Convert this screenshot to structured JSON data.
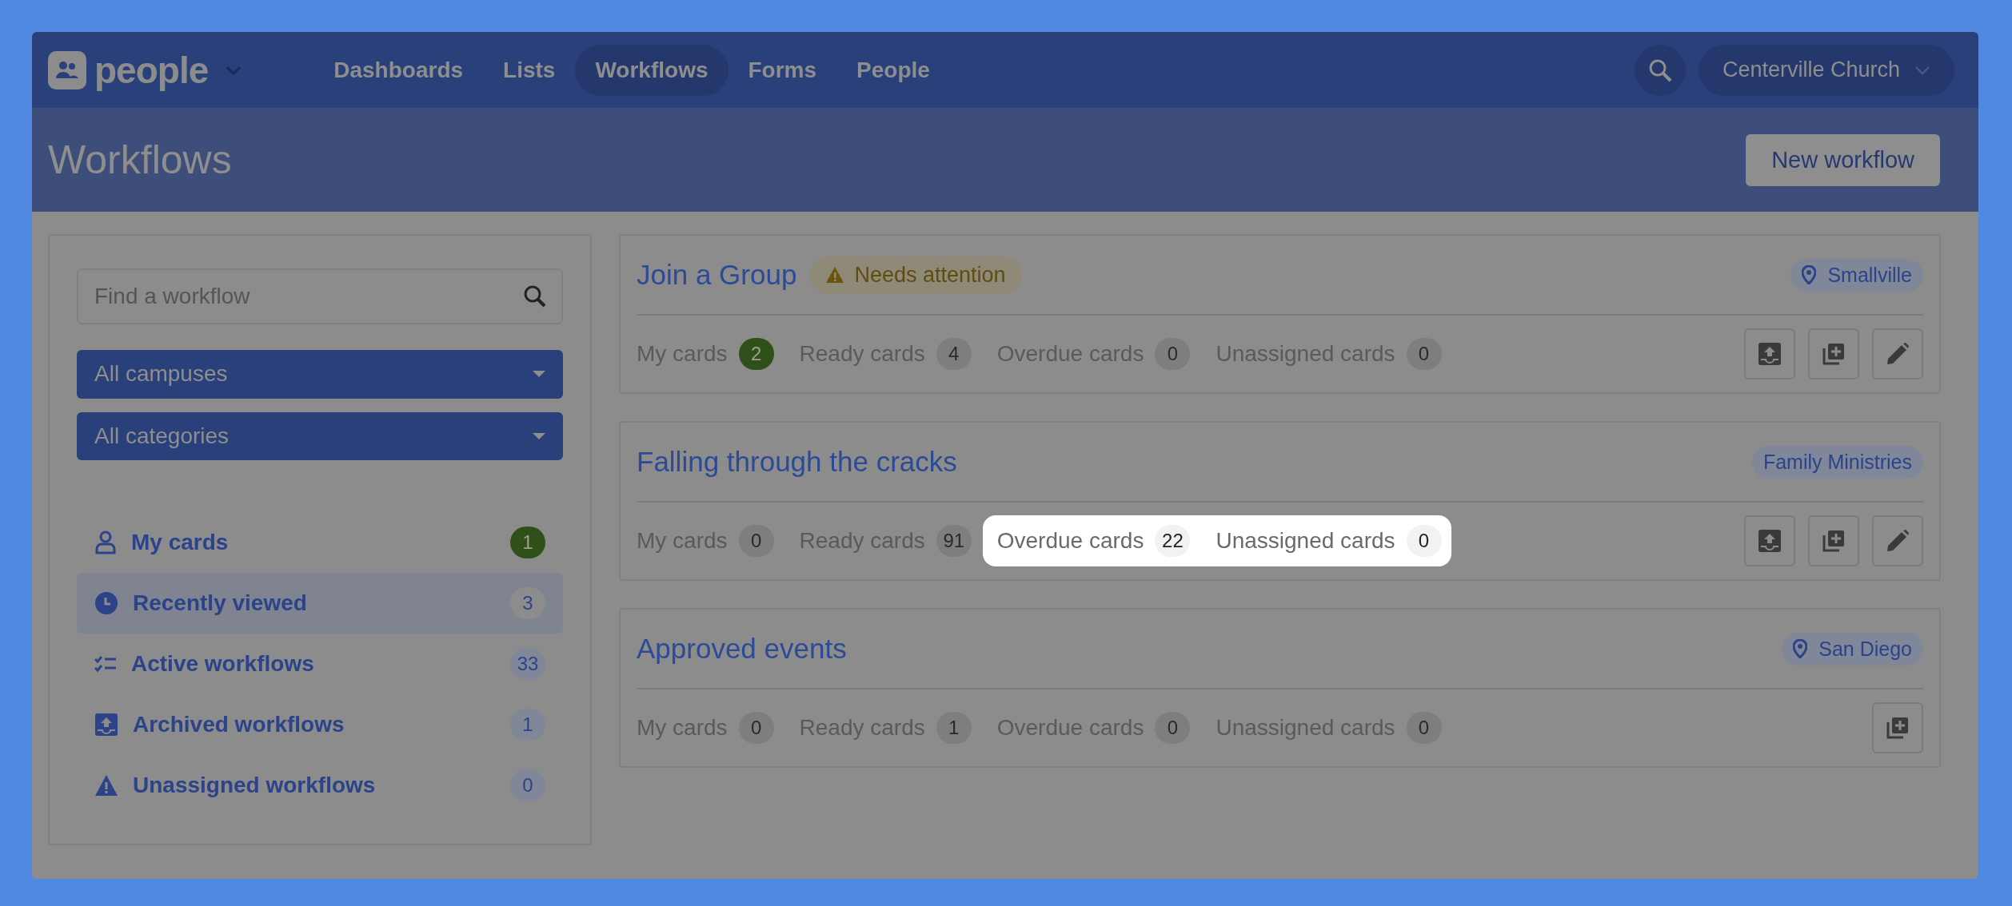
{
  "brand": {
    "name": "people"
  },
  "nav": [
    {
      "label": "Dashboards",
      "selected": false
    },
    {
      "label": "Lists",
      "selected": false
    },
    {
      "label": "Workflows",
      "selected": true
    },
    {
      "label": "Forms",
      "selected": false
    },
    {
      "label": "People",
      "selected": false
    }
  ],
  "account": {
    "label": "Centerville Church"
  },
  "header": {
    "title": "Workflows",
    "button": "New workflow"
  },
  "sidebar": {
    "search": {
      "placeholder": "Find a workflow"
    },
    "filters": [
      {
        "label": "All campuses"
      },
      {
        "label": "All categories"
      }
    ],
    "items": [
      {
        "kind": "person",
        "label": "My cards",
        "count": "1",
        "attention": true,
        "selected": false
      },
      {
        "kind": "clock",
        "label": "Recently viewed",
        "count": "3",
        "attention": false,
        "selected": true
      },
      {
        "kind": "checklist",
        "label": "Active workflows",
        "count": "33",
        "attention": false,
        "selected": false
      },
      {
        "kind": "archive",
        "label": "Archived workflows",
        "count": "1",
        "attention": false,
        "selected": false
      },
      {
        "kind": "warning",
        "label": "Unassigned workflows",
        "count": "0",
        "attention": false,
        "selected": false
      }
    ]
  },
  "workflows": [
    {
      "title": "Join a Group",
      "status": "Needs attention",
      "tag": {
        "label": "Smallville",
        "pin": true
      },
      "stats": [
        {
          "label": "My cards",
          "count": "2",
          "attention": true,
          "highlighted": false
        },
        {
          "label": "Ready cards",
          "count": "4",
          "attention": false,
          "highlighted": false
        },
        {
          "label": "Overdue cards",
          "count": "0",
          "attention": false,
          "highlighted": false
        },
        {
          "label": "Unassigned cards",
          "count": "0",
          "attention": false,
          "highlighted": false
        }
      ],
      "actions": [
        {
          "kind": "archive"
        },
        {
          "kind": "add"
        },
        {
          "kind": "edit"
        }
      ]
    },
    {
      "title": "Falling through the cracks",
      "tag": {
        "label": "Family Ministries",
        "pin": false
      },
      "stats": [
        {
          "label": "My cards",
          "count": "0",
          "attention": false,
          "highlighted": false
        },
        {
          "label": "Ready cards",
          "count": "91",
          "attention": false,
          "highlighted": false
        },
        {
          "label": "Overdue cards",
          "count": "22",
          "attention": false,
          "highlighted": true
        },
        {
          "label": "Unassigned cards",
          "count": "0",
          "attention": false,
          "highlighted": true
        }
      ],
      "actions": [
        {
          "kind": "archive"
        },
        {
          "kind": "add"
        },
        {
          "kind": "edit"
        }
      ]
    },
    {
      "title": "Approved events",
      "tag": {
        "label": "San Diego",
        "pin": true
      },
      "stats": [
        {
          "label": "My cards",
          "count": "0",
          "attention": false,
          "highlighted": false
        },
        {
          "label": "Ready cards",
          "count": "1",
          "attention": false,
          "highlighted": false
        },
        {
          "label": "Overdue cards",
          "count": "0",
          "attention": false,
          "highlighted": false
        },
        {
          "label": "Unassigned cards",
          "count": "0",
          "attention": false,
          "highlighted": false
        }
      ],
      "actions": [
        {
          "kind": "add"
        }
      ]
    }
  ]
}
